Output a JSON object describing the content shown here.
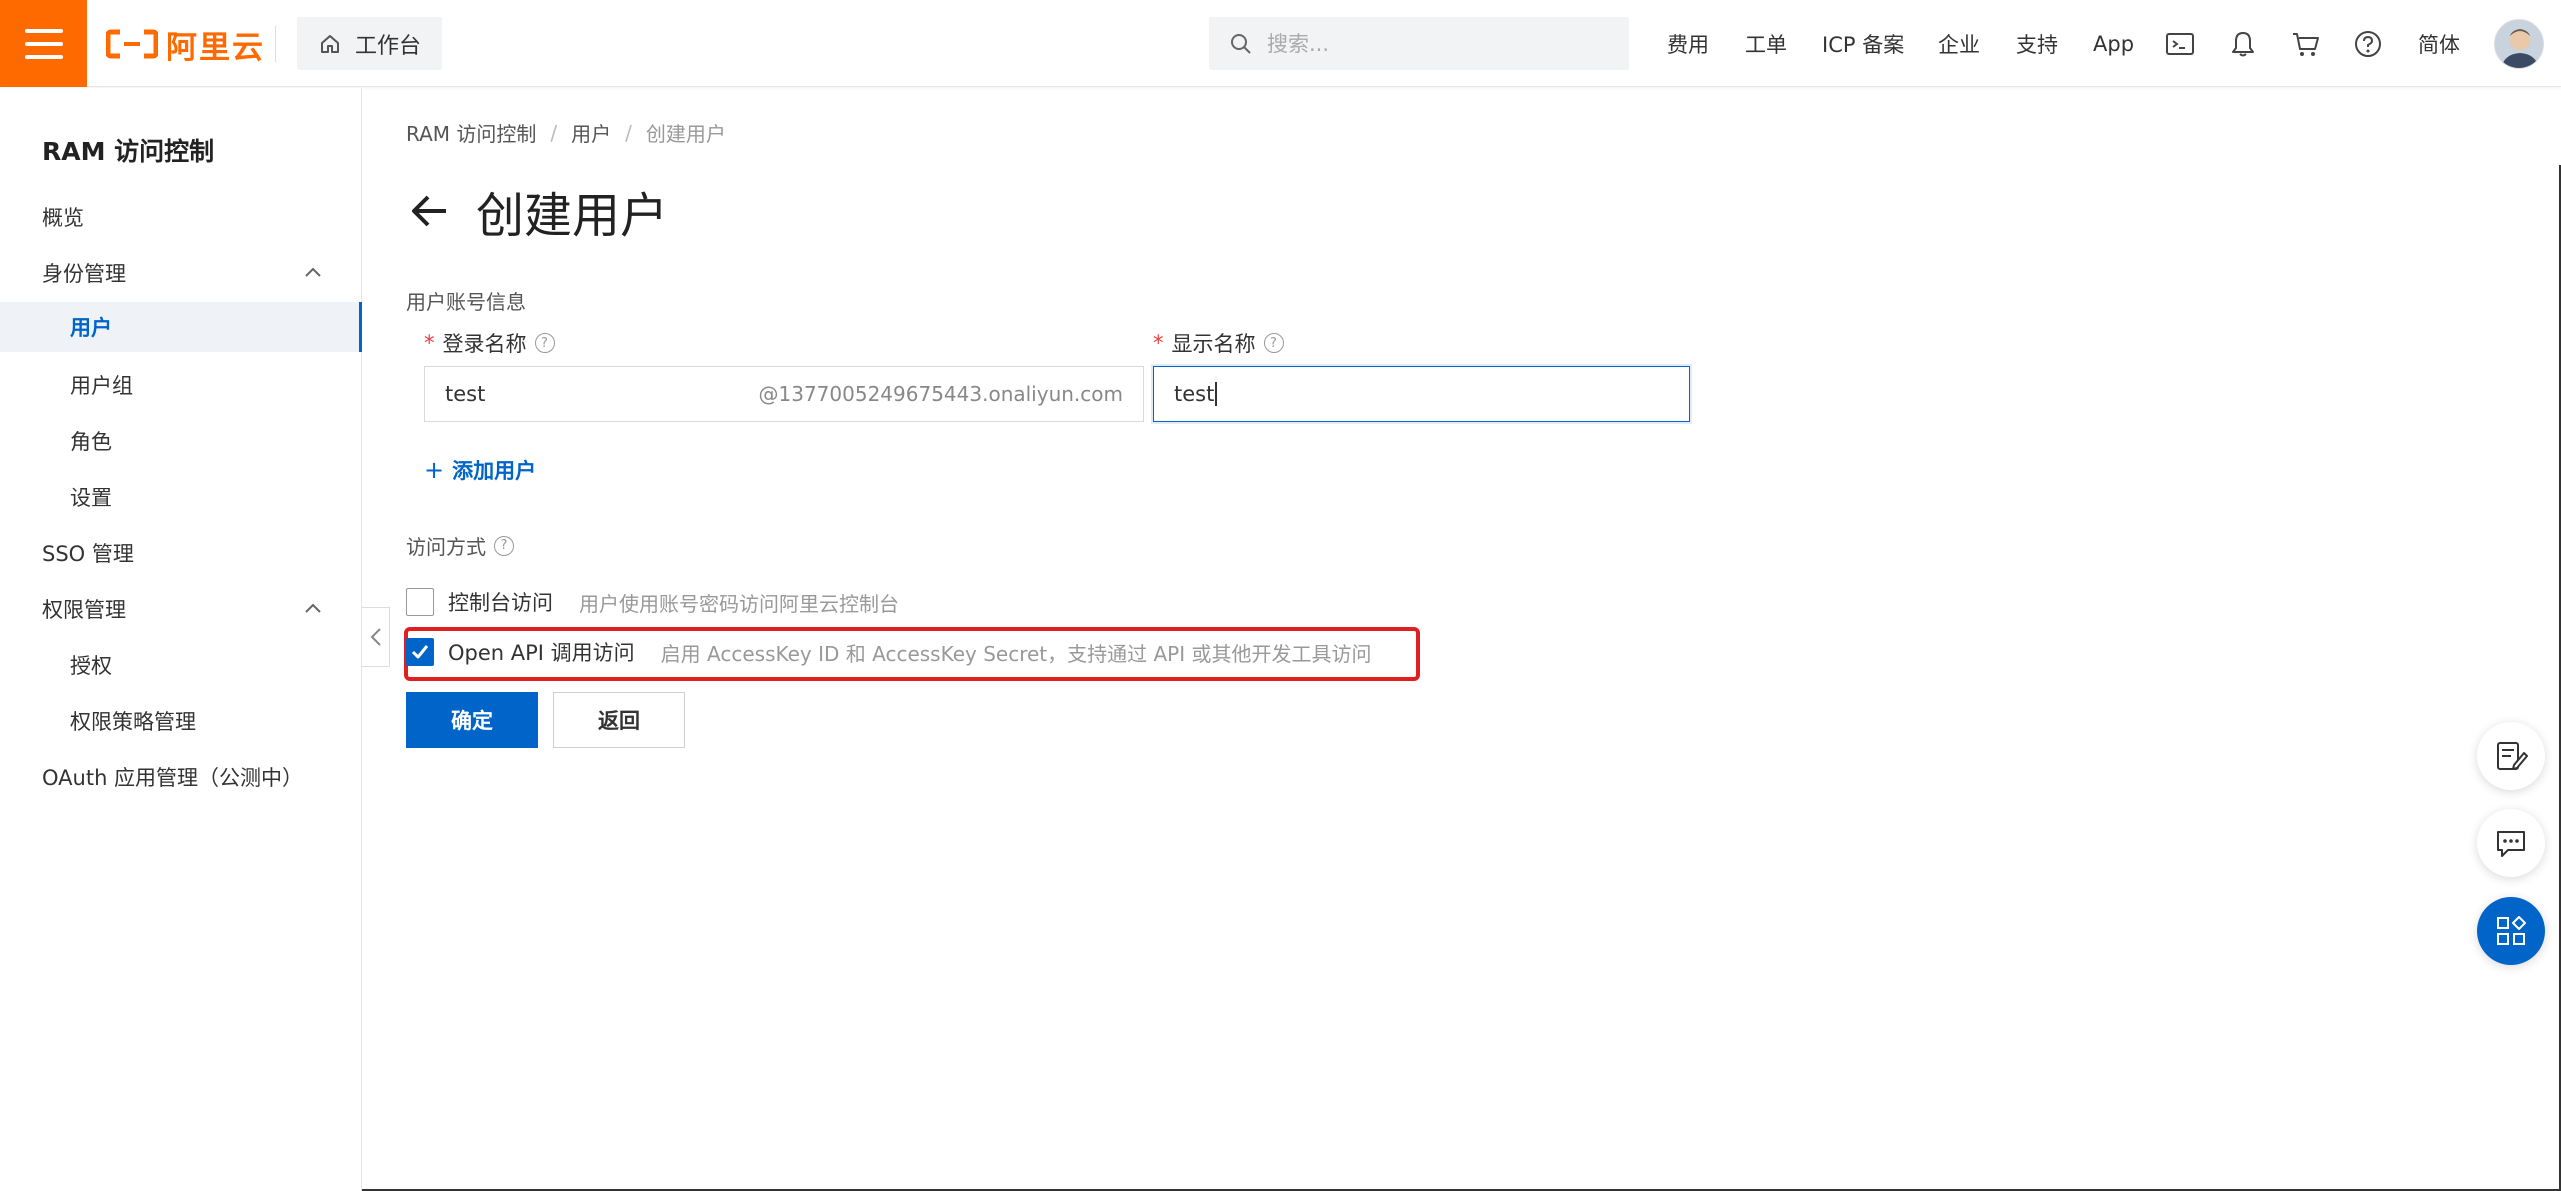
{
  "header": {
    "logo_text": "阿里云",
    "workbench_label": "工作台",
    "search_placeholder": "搜索...",
    "nav": [
      "费用",
      "工单",
      "ICP 备案",
      "企业",
      "支持",
      "App"
    ],
    "lang_label": "简体"
  },
  "sidebar": {
    "title": "RAM 访问控制",
    "items": [
      {
        "label": "概览"
      },
      {
        "label": "身份管理"
      },
      {
        "label": "用户"
      },
      {
        "label": "用户组"
      },
      {
        "label": "角色"
      },
      {
        "label": "设置"
      },
      {
        "label": "SSO 管理"
      },
      {
        "label": "权限管理"
      },
      {
        "label": "授权"
      },
      {
        "label": "权限策略管理"
      },
      {
        "label": "OAuth 应用管理（公测中）"
      }
    ]
  },
  "breadcrumb": [
    "RAM 访问控制",
    "用户",
    "创建用户"
  ],
  "page": {
    "title": "创建用户",
    "account_section": "用户账号信息",
    "login_name": {
      "label": "登录名称",
      "value": "test",
      "suffix": "@1377005249675443.onaliyun.com"
    },
    "display_name": {
      "label": "显示名称",
      "value": "test"
    },
    "add_user_label": "添加用户",
    "access_section": "访问方式",
    "console_access": {
      "label": "控制台访问",
      "desc": "用户使用账号密码访问阿里云控制台",
      "checked": false
    },
    "api_access": {
      "label": "Open API 调用访问",
      "desc": "启用 AccessKey ID 和 AccessKey Secret，支持通过 API 或其他开发工具访问",
      "checked": true
    },
    "confirm_label": "确定",
    "back_label": "返回"
  },
  "colors": {
    "brand": "#ff6a00",
    "primary": "#0064c8",
    "highlight": "#e02020"
  }
}
